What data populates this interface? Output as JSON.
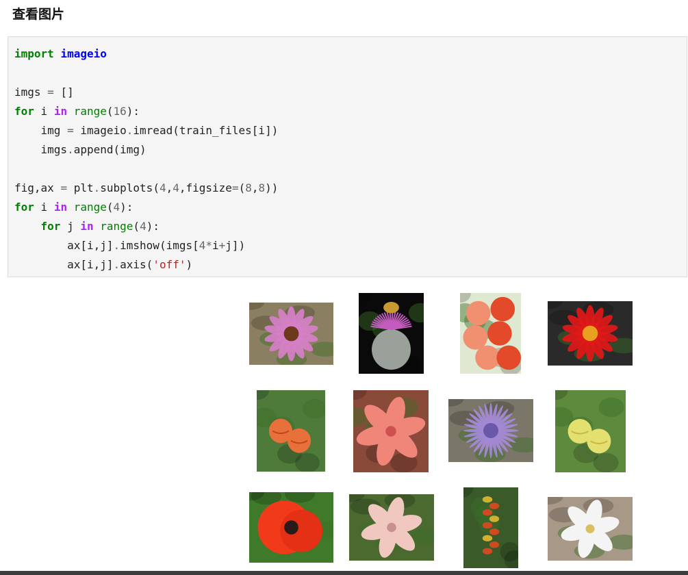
{
  "page": {
    "heading": "查看图片"
  },
  "code_cell": {
    "lines": [
      [
        {
          "t": "import",
          "c": "kw"
        },
        {
          "t": " "
        },
        {
          "t": "imageio",
          "c": "mod"
        }
      ],
      [],
      [
        {
          "t": "imgs "
        },
        {
          "t": "=",
          "c": "op"
        },
        {
          "t": " []"
        }
      ],
      [
        {
          "t": "for",
          "c": "kw"
        },
        {
          "t": " i "
        },
        {
          "t": "in",
          "c": "kw2"
        },
        {
          "t": " "
        },
        {
          "t": "range",
          "c": "bi"
        },
        {
          "t": "("
        },
        {
          "t": "16",
          "c": "num"
        },
        {
          "t": "):"
        }
      ],
      [
        {
          "t": "    img "
        },
        {
          "t": "=",
          "c": "op"
        },
        {
          "t": " imageio"
        },
        {
          "t": ".",
          "c": "op"
        },
        {
          "t": "imread(train_files[i])"
        }
      ],
      [
        {
          "t": "    imgs"
        },
        {
          "t": ".",
          "c": "op"
        },
        {
          "t": "append(img)"
        }
      ],
      [],
      [
        {
          "t": "fig,ax "
        },
        {
          "t": "=",
          "c": "op"
        },
        {
          "t": " plt"
        },
        {
          "t": ".",
          "c": "op"
        },
        {
          "t": "subplots("
        },
        {
          "t": "4",
          "c": "num"
        },
        {
          "t": ","
        },
        {
          "t": "4",
          "c": "num"
        },
        {
          "t": ",figsize"
        },
        {
          "t": "=",
          "c": "op"
        },
        {
          "t": "("
        },
        {
          "t": "8",
          "c": "num"
        },
        {
          "t": ","
        },
        {
          "t": "8",
          "c": "num"
        },
        {
          "t": "))"
        }
      ],
      [
        {
          "t": "for",
          "c": "kw"
        },
        {
          "t": " i "
        },
        {
          "t": "in",
          "c": "kw2"
        },
        {
          "t": " "
        },
        {
          "t": "range",
          "c": "bi"
        },
        {
          "t": "("
        },
        {
          "t": "4",
          "c": "num"
        },
        {
          "t": "):"
        }
      ],
      [
        {
          "t": "    "
        },
        {
          "t": "for",
          "c": "kw"
        },
        {
          "t": " j "
        },
        {
          "t": "in",
          "c": "kw2"
        },
        {
          "t": " "
        },
        {
          "t": "range",
          "c": "bi"
        },
        {
          "t": "("
        },
        {
          "t": "4",
          "c": "num"
        },
        {
          "t": "):"
        }
      ],
      [
        {
          "t": "        ax[i,j]"
        },
        {
          "t": ".",
          "c": "op"
        },
        {
          "t": "imshow(imgs["
        },
        {
          "t": "4",
          "c": "num"
        },
        {
          "t": "*",
          "c": "op"
        },
        {
          "t": "i"
        },
        {
          "t": "+",
          "c": "op"
        },
        {
          "t": "j])"
        }
      ],
      [
        {
          "t": "        ax[i,j]"
        },
        {
          "t": ".",
          "c": "op"
        },
        {
          "t": "axis("
        },
        {
          "t": "'off'",
          "c": "str"
        },
        {
          "t": ")"
        }
      ]
    ]
  },
  "output": {
    "images": [
      {
        "name": "flower-image-coneflower",
        "bg": "#8a7f60",
        "petal": "#d67fc8",
        "center": "#6b3a1a",
        "type": "daisy"
      },
      {
        "name": "flower-image-thistle",
        "bg": "#0a0a0a",
        "petal": "#c45cc0",
        "center": "#9aa09a",
        "type": "thistle"
      },
      {
        "name": "flower-image-gladiolus-red",
        "bg": "#dfe8d0",
        "petal": "#e24a2a",
        "center": "#f09070",
        "type": "cluster"
      },
      {
        "name": "flower-image-dahlia-red",
        "bg": "#2a2a2a",
        "petal": "#e01818",
        "center": "#e8a020",
        "type": "daisy"
      },
      {
        "name": "flower-image-abutilon",
        "bg": "#4e7a3a",
        "petal": "#e8703a",
        "center": "#c04818",
        "type": "bells"
      },
      {
        "name": "flower-image-tiger-lily",
        "bg": "#8a4a3a",
        "petal": "#f0857a",
        "center": "#d05050",
        "type": "lily"
      },
      {
        "name": "flower-image-monarda-purple",
        "bg": "#7a7668",
        "petal": "#a48ad8",
        "center": "#6a58a8",
        "type": "spiky"
      },
      {
        "name": "flower-image-abutilon-yellow",
        "bg": "#5e8a3e",
        "petal": "#e4e070",
        "center": "#c8b840",
        "type": "bells"
      },
      {
        "name": "flower-image-poppy",
        "bg": "#3f7a2a",
        "petal": "#f03a1a",
        "center": "#2a1a1a",
        "type": "poppy"
      },
      {
        "name": "flower-image-magnolia",
        "bg": "#4a6a30",
        "petal": "#f0c8c0",
        "center": "#c89090",
        "type": "lily"
      },
      {
        "name": "flower-image-spike-flower",
        "bg": "#3a5a2a",
        "petal": "#d04a20",
        "center": "#d0b030",
        "type": "spike"
      },
      {
        "name": "flower-image-orchid-white",
        "bg": "#a89888",
        "petal": "#f4f4f4",
        "center": "#d8c060",
        "type": "orchid"
      }
    ]
  }
}
